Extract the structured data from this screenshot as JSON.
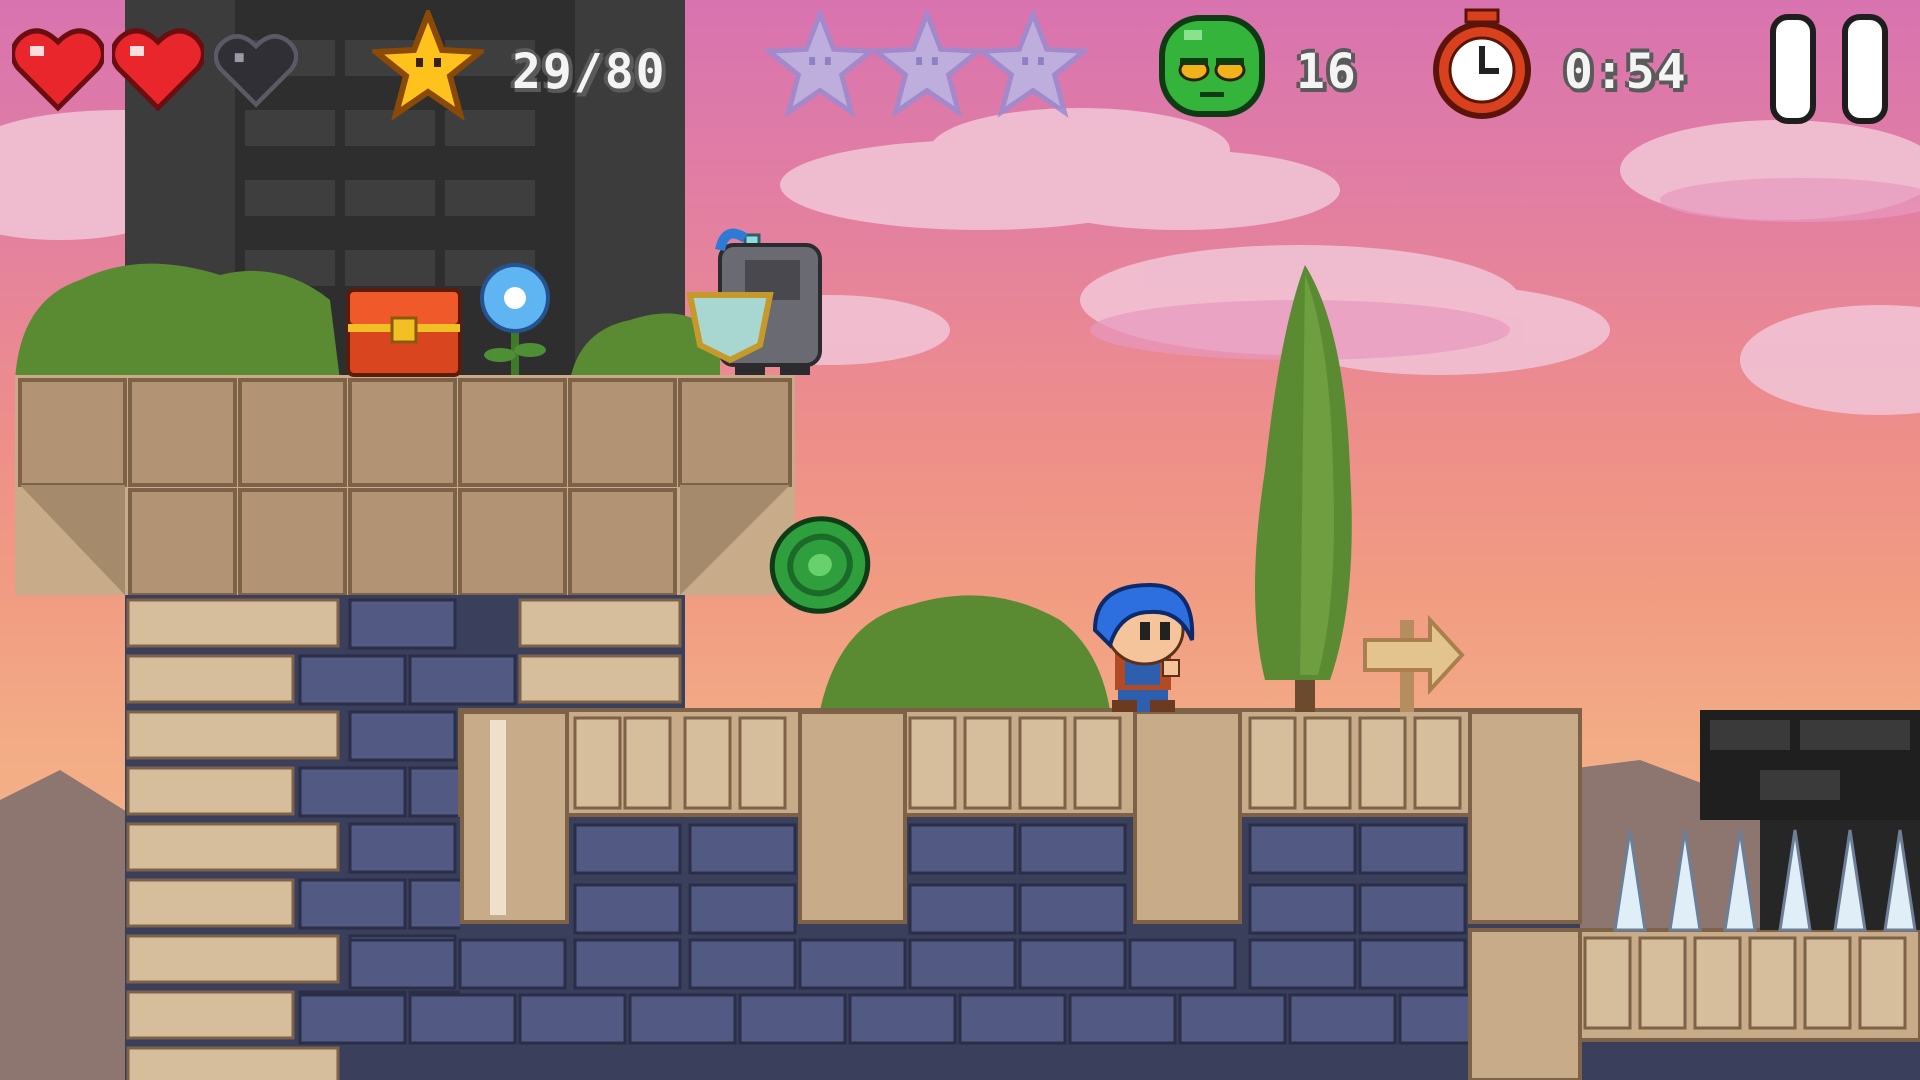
{
  "hud": {
    "hearts": [
      {
        "icon": "heart-full-icon",
        "state": "full"
      },
      {
        "icon": "heart-full-icon",
        "state": "full"
      },
      {
        "icon": "heart-empty-icon",
        "state": "empty"
      }
    ],
    "stars_collected_label": "29/80",
    "big_stars": [
      {
        "icon": "big-star-icon",
        "collected": false
      },
      {
        "icon": "big-star-icon",
        "collected": false
      },
      {
        "icon": "big-star-icon",
        "collected": false
      }
    ],
    "enemies_label": "16",
    "timer_label": "0:54",
    "pause_icon": "pause-icon"
  },
  "colors": {
    "heart_red": "#e8262c",
    "star_gold": "#ffc21c",
    "slime_green": "#35b43b",
    "clock_red": "#d9411e",
    "stone_tan": "#c8ab88",
    "brick_blue": "#454d73",
    "tower_dark": "#2b2b2b"
  },
  "scene": {
    "player": "blue-haired-boy",
    "enemy": "armored-knight",
    "pickups": [
      "treasure-chest",
      "blue-flower",
      "green-gem"
    ],
    "props": [
      "cypress-tree",
      "wooden-arrow-sign",
      "spike-row"
    ]
  }
}
